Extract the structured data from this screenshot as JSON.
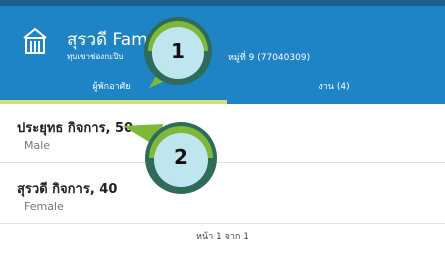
{
  "header": {
    "title": "สุรวดี Famil",
    "subtitle": "ทุบเขาช่องกะปิบ",
    "address": "หมู่ที่ 9 (77040309)"
  },
  "tabs": [
    {
      "label": "ผู้พักอาศัย",
      "active": true
    },
    {
      "label": "งาน (4)",
      "active": false
    }
  ],
  "members": [
    {
      "name": "ประยุทธ กิจการ, 50",
      "gender": "Male"
    },
    {
      "name": "สุรวดี กิจการ, 40",
      "gender": "Female"
    }
  ],
  "pagination": {
    "label": "หน้า 1 จาก 1"
  },
  "callouts": [
    {
      "number": "1"
    },
    {
      "number": "2"
    }
  ],
  "colors": {
    "header": "#1e84c6",
    "tab_indicator": "#d6de7a",
    "callout_ring": "#2e6b5a",
    "callout_fill": "#bfe6ef",
    "callout_accent": "#7eb83a"
  }
}
